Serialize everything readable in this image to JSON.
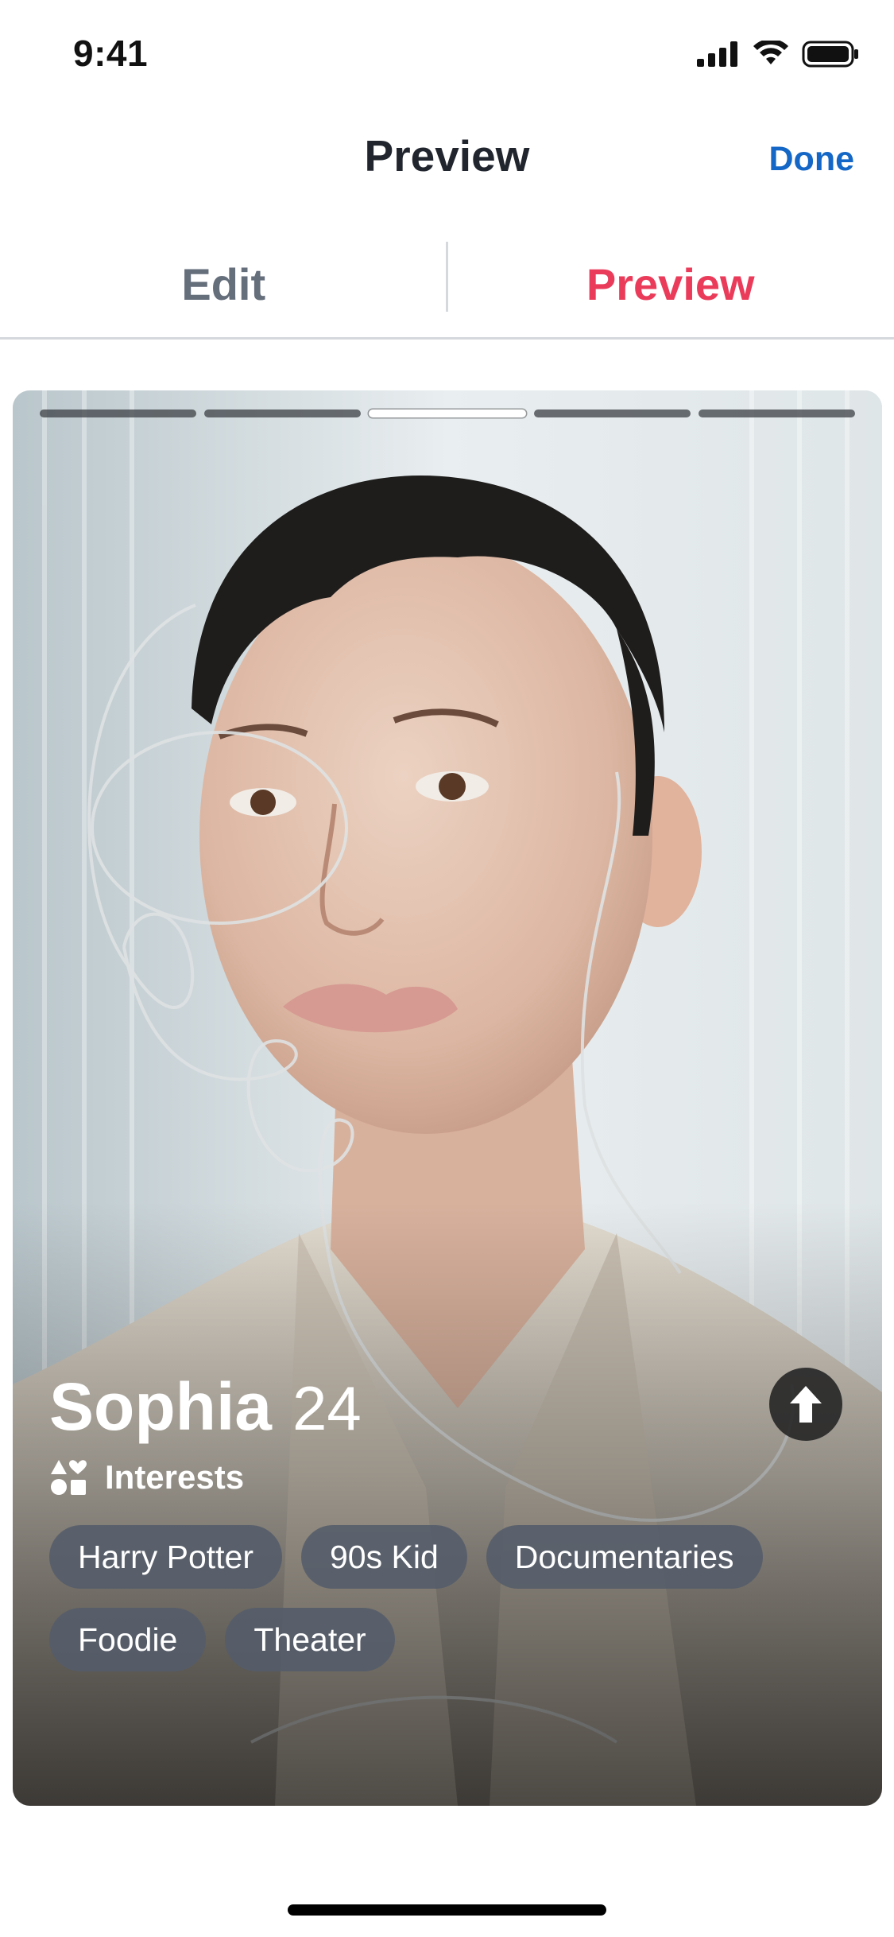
{
  "status_bar": {
    "time": "9:41"
  },
  "nav": {
    "title": "Preview",
    "done_label": "Done"
  },
  "tabs": [
    {
      "label": "Edit",
      "selected": false
    },
    {
      "label": "Preview",
      "selected": true
    }
  ],
  "card": {
    "photo_count": 5,
    "active_photo_index": 2,
    "name": "Sophia",
    "age": "24",
    "interests_label": "Interests",
    "interests": [
      "Harry Potter",
      "90s Kid",
      "Documentaries",
      "Foodie",
      "Theater"
    ]
  },
  "colors": {
    "accent_red": "#ea3c5a",
    "link_blue": "#1467c6",
    "tab_inactive": "#656e7b"
  }
}
